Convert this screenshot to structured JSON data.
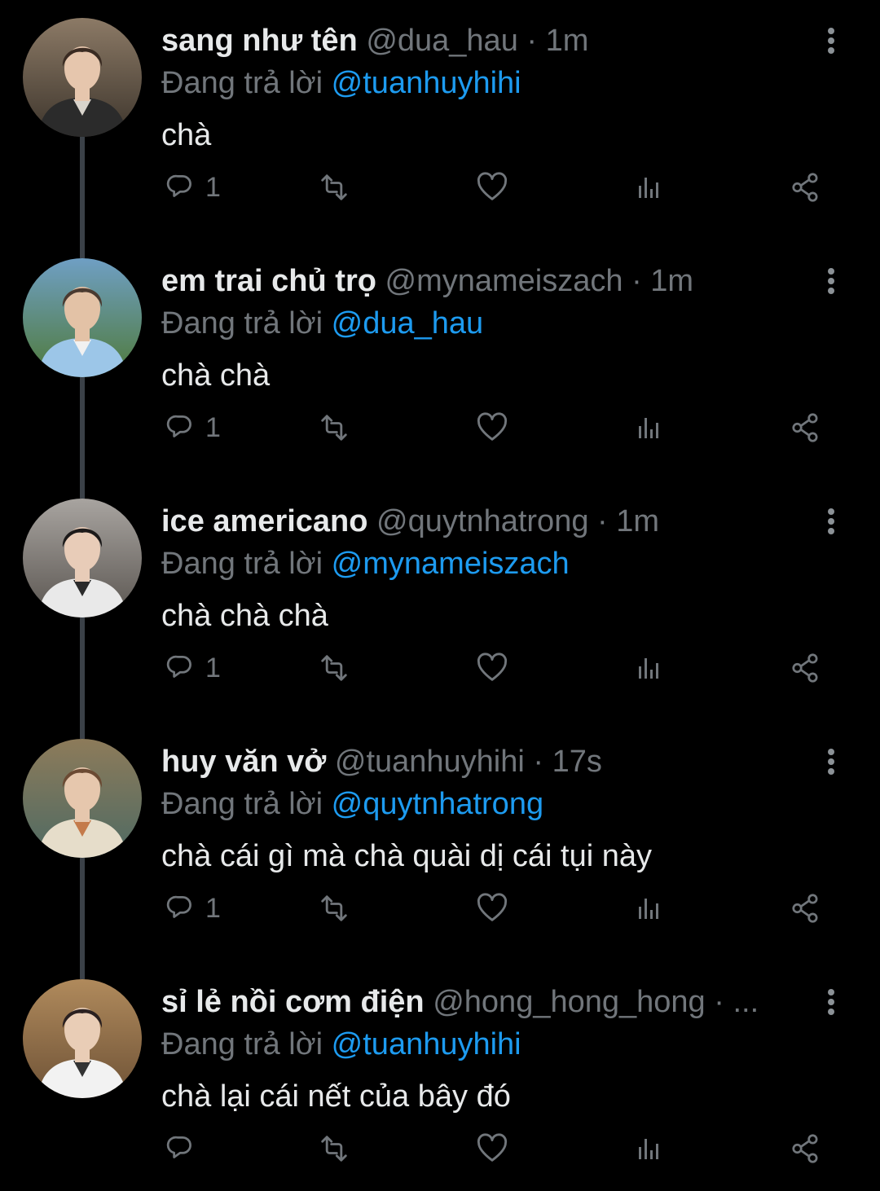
{
  "colors": {
    "background": "#000000",
    "name": "#e7e9ea",
    "muted": "#71767b",
    "mention": "#1d9bf0",
    "thread_line": "#3b4148"
  },
  "tweets": [
    {
      "name": "sang như tên",
      "handle": "@dua_hau",
      "separator": "·",
      "time": "1m",
      "reply_prefix": "Đang trả lời",
      "reply_to": "@tuanhuyhihi",
      "text": "chà",
      "reply_count": "1",
      "icons": [
        "reply-icon",
        "retweet-icon",
        "like-icon",
        "views-icon",
        "share-icon",
        "more-icon"
      ]
    },
    {
      "name": "em trai chủ trọ",
      "handle": "@mynameiszach",
      "separator": "·",
      "time": "1m",
      "reply_prefix": "Đang trả lời",
      "reply_to": "@dua_hau",
      "text": "chà chà",
      "reply_count": "1",
      "icons": [
        "reply-icon",
        "retweet-icon",
        "like-icon",
        "views-icon",
        "share-icon",
        "more-icon"
      ]
    },
    {
      "name": "ice americano",
      "handle": "@quytnhatrong",
      "separator": "·",
      "time": "1m",
      "reply_prefix": "Đang trả lời",
      "reply_to": "@mynameiszach",
      "text": "chà chà chà",
      "reply_count": "1",
      "icons": [
        "reply-icon",
        "retweet-icon",
        "like-icon",
        "views-icon",
        "share-icon",
        "more-icon"
      ]
    },
    {
      "name": "huy văn vở",
      "handle": "@tuanhuyhihi",
      "separator": "·",
      "time": "17s",
      "reply_prefix": "Đang trả lời",
      "reply_to": "@quytnhatrong",
      "text": "chà cái gì mà chà quài dị cái tụi này",
      "reply_count": "1",
      "icons": [
        "reply-icon",
        "retweet-icon",
        "like-icon",
        "views-icon",
        "share-icon",
        "more-icon"
      ]
    },
    {
      "name": "sỉ lẻ nồi cơm điện",
      "handle": "@hong_hong_hong",
      "separator": "·",
      "time": "...",
      "reply_prefix": "Đang trả lời",
      "reply_to": "@tuanhuyhihi",
      "text": "chà lại cái nết của bây đó",
      "reply_count": "",
      "icons": [
        "reply-icon",
        "retweet-icon",
        "like-icon",
        "views-icon",
        "share-icon",
        "more-icon"
      ]
    }
  ]
}
